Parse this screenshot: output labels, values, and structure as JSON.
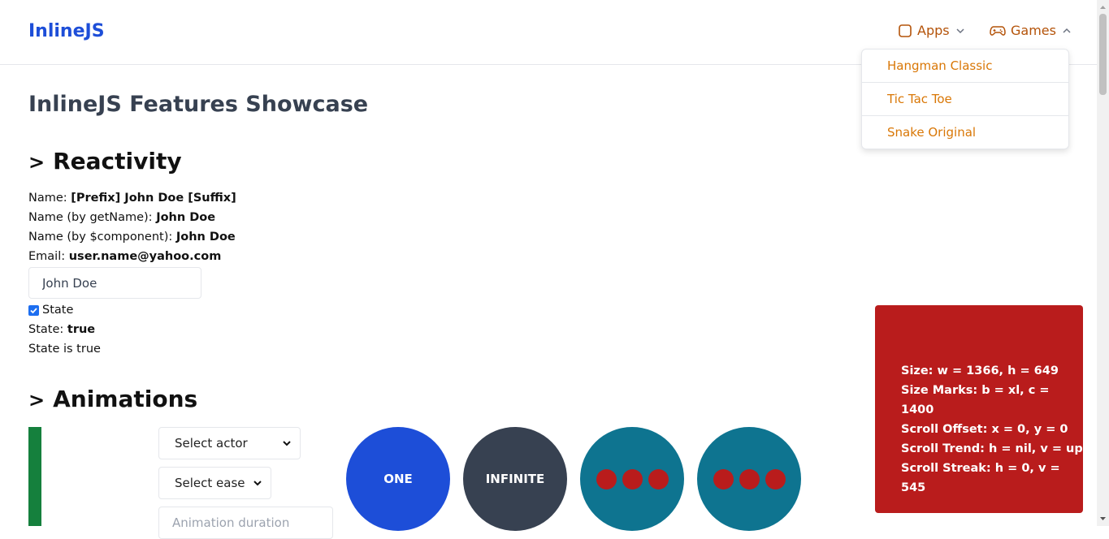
{
  "navbar": {
    "brand": "InlineJS",
    "apps_label": "Apps",
    "games_label": "Games",
    "games_menu": [
      "Hangman Classic",
      "Tic Tac Toe",
      "Snake Original"
    ]
  },
  "page": {
    "title": "InlineJS Features Showcase"
  },
  "reactivity": {
    "title": "Reactivity",
    "name_label": "Name:",
    "name_value": "[Prefix] John Doe [Suffix]",
    "getname_label": "Name (by getName):",
    "getname_value": "John Doe",
    "component_label": "Name (by $component):",
    "component_value": "John Doe",
    "email_label": "Email:",
    "email_value": "user.name@yahoo.com",
    "input_value": "John Doe",
    "checkbox_label": "State",
    "state_label": "State:",
    "state_value": "true",
    "state_text": "State is true"
  },
  "animations": {
    "title": "Animations",
    "actor_select": "Select actor",
    "ease_select": "Select ease",
    "duration_placeholder": "Animation duration",
    "circles": [
      {
        "label": "ONE",
        "color": "#1d4ed8"
      },
      {
        "label": "INFINITE",
        "color": "#374151"
      },
      {
        "label": "",
        "color": "#0e7490"
      },
      {
        "label": "",
        "color": "#0e7490"
      }
    ]
  },
  "size_panel": {
    "lines": [
      "Size: w = 1366, h = 649",
      "Size Marks: b = xl, c = 1400",
      "Scroll Offset: x = 0, y = 0",
      "Scroll Trend: h = nil, v = up",
      "Scroll Streak: h = 0, v = 545"
    ]
  },
  "colors": {
    "brand": "#1d4ed8",
    "nav_accent": "#b45309",
    "menu_item": "#d97706",
    "panel": "#b91c1c",
    "bar": "#15803d"
  }
}
